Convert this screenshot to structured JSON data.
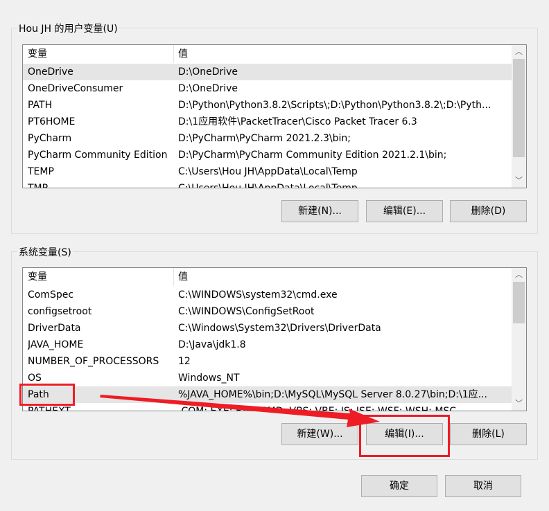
{
  "user_vars": {
    "title": "Hou JH 的用户变量(U)",
    "columns": [
      "变量",
      "值"
    ],
    "rows": [
      {
        "name": "OneDrive",
        "value": "D:\\OneDrive",
        "selected": true
      },
      {
        "name": "OneDriveConsumer",
        "value": "D:\\OneDrive"
      },
      {
        "name": "PATH",
        "value": "D:\\Python\\Python3.8.2\\Scripts\\;D:\\Python\\Python3.8.2\\;D:\\Pyth..."
      },
      {
        "name": "PT6HOME",
        "value": "D:\\1应用软件\\PacketTracer\\Cisco Packet Tracer 6.3"
      },
      {
        "name": "PyCharm",
        "value": "D:\\PyCharm\\PyCharm 2021.2.3\\bin;"
      },
      {
        "name": "PyCharm Community Edition",
        "value": "D:\\PyCharm\\PyCharm Community Edition 2021.2.1\\bin;"
      },
      {
        "name": "TEMP",
        "value": "C:\\Users\\Hou JH\\AppData\\Local\\Temp"
      },
      {
        "name": "TMP",
        "value": "C:\\Users\\Hou JH\\AppData\\Local\\Temp"
      }
    ],
    "buttons": {
      "new": "新建(N)...",
      "edit": "编辑(E)...",
      "delete": "删除(D)"
    }
  },
  "system_vars": {
    "title": "系统变量(S)",
    "columns": [
      "变量",
      "值"
    ],
    "rows": [
      {
        "name": "ComSpec",
        "value": "C:\\WINDOWS\\system32\\cmd.exe"
      },
      {
        "name": "configsetroot",
        "value": "C:\\WINDOWS\\ConfigSetRoot"
      },
      {
        "name": "DriverData",
        "value": "C:\\Windows\\System32\\Drivers\\DriverData"
      },
      {
        "name": "JAVA_HOME",
        "value": "D:\\Java\\jdk1.8"
      },
      {
        "name": "NUMBER_OF_PROCESSORS",
        "value": "12"
      },
      {
        "name": "OS",
        "value": "Windows_NT"
      },
      {
        "name": "Path",
        "value": "%JAVA_HOME%\\bin;D:\\MySQL\\MySQL Server 8.0.27\\bin;D:\\1应...",
        "selected": true
      },
      {
        "name": "PATHEXT",
        "value": ".COM;.EXE;.BAT;.CMD;.VBS;.VBE;.JS;.JSE;.WSF;.WSH;.MSC"
      }
    ],
    "buttons": {
      "new": "新建(W)...",
      "edit": "编辑(I)...",
      "delete": "删除(L)"
    }
  },
  "footer": {
    "ok": "确定",
    "cancel": "取消"
  },
  "annotation_color": "#ee1c25",
  "icons": {
    "scroll_up": "chevron-up-icon",
    "scroll_down": "chevron-down-icon"
  }
}
